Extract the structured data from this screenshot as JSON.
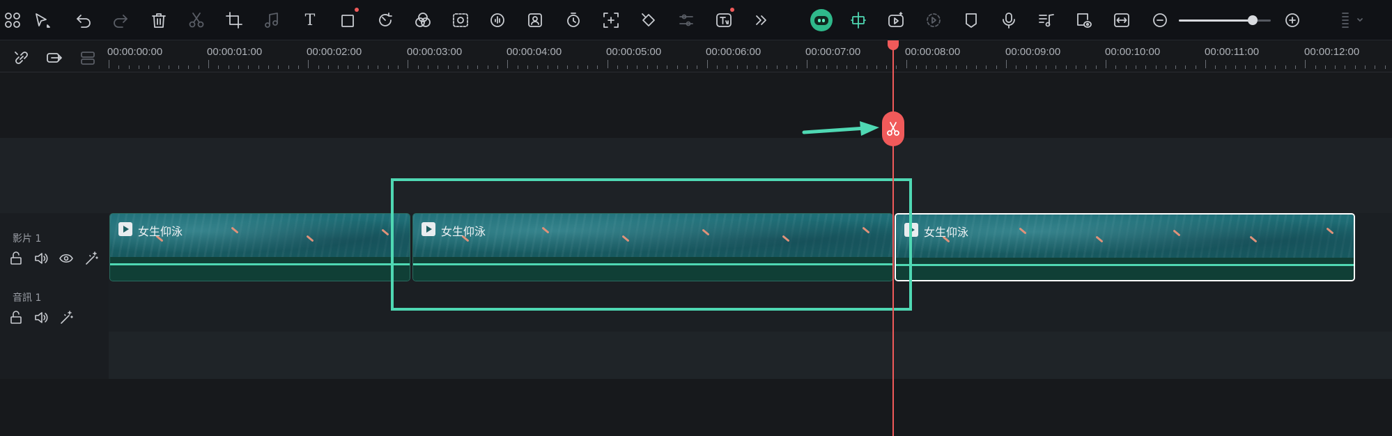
{
  "colors": {
    "accent": "#4fd8b3",
    "playhead": "#f05a5a",
    "badge": "#f05a5a",
    "clip": "#1b6a70",
    "toolbar_bg": "#101216",
    "timeline_bg": "#17191c"
  },
  "toolbar": {
    "icons": [
      "layout-icon",
      "select-tool-icon",
      "undo-icon",
      "redo-icon",
      "delete-icon",
      "split-icon",
      "crop-icon",
      "audio-icon",
      "text-icon",
      "shape-icon",
      "speed-icon",
      "color-icon",
      "mask-icon",
      "ai-audio-icon",
      "ai-portrait-icon",
      "timer-icon",
      "freeze-icon",
      "keyframe-icon",
      "adjust-icon",
      "ai-text-icon",
      "more-icon",
      "ai-mate-icon",
      "snap-icon",
      "ai-video-icon",
      "render-icon",
      "marker-icon",
      "microphone-icon",
      "music-icon",
      "preview-icon",
      "fit-icon",
      "zoom-out-icon",
      "zoom-in-icon",
      "layout-menu-icon"
    ],
    "text_tool_glyph": "T",
    "zoom_level": 0.8
  },
  "ruler": {
    "timecodes": [
      "00:00:00:00",
      "00:00:01:00",
      "00:00:02:00",
      "00:00:03:00",
      "00:00:04:00",
      "00:00:05:00",
      "00:00:06:00",
      "00:00:07:00",
      "00:00:08:00",
      "00:00:09:00",
      "00:00:10:00",
      "00:00:11:00",
      "00:00:12:00"
    ],
    "tools": [
      "link-icon",
      "group-icon",
      "ungroup-icon"
    ]
  },
  "tracks": {
    "video": {
      "label": "影片 1",
      "icons": [
        "lock-icon",
        "volume-icon",
        "eye-icon",
        "magic-icon"
      ]
    },
    "audio": {
      "label": "音訊 1",
      "icons": [
        "lock-icon",
        "volume-icon",
        "magic-icon"
      ]
    }
  },
  "clips": [
    {
      "title": "女生仰泳",
      "selected": false
    },
    {
      "title": "女生仰泳",
      "selected": false
    },
    {
      "title": "女生仰泳",
      "selected": true
    }
  ],
  "playhead": {
    "position_seconds": 7.9,
    "action_icon": "scissors-icon"
  }
}
